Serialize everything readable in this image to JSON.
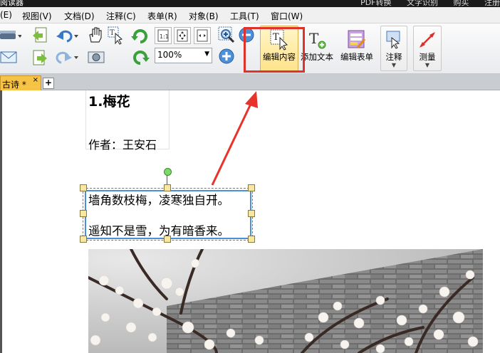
{
  "window": {
    "title": "阅读器",
    "right_items": [
      "PDF转换",
      "文字识别",
      "购买",
      "注册"
    ]
  },
  "menubar": {
    "items": [
      "(E)",
      "视图(V)",
      "文档(D)",
      "注释(C)",
      "表单(R)",
      "对象(B)",
      "工具(T)",
      "窗口(W)"
    ]
  },
  "toolbar": {
    "zoom_value": "100%",
    "edit_content_label": "编辑内容",
    "add_text_label": "添加文本",
    "edit_form_label": "编辑表单",
    "annotate_label": "注释",
    "measure_label": "测量",
    "highlight_color": "#e0312b"
  },
  "tabs": {
    "doc_tab_label": "古诗 *",
    "close_glyph": "×",
    "new_tab_glyph": "+"
  },
  "document": {
    "poem_title": "1.梅花",
    "author": "作者：王安石",
    "line1_before_caret": "墙角数枝梅，凌寒独自开",
    "line1_after_caret": "。",
    "line2": "遥知不是雪，为有暗香来。"
  },
  "annotation": {
    "arrow_color": "#e8332c",
    "frame_color": "#e0312b"
  }
}
